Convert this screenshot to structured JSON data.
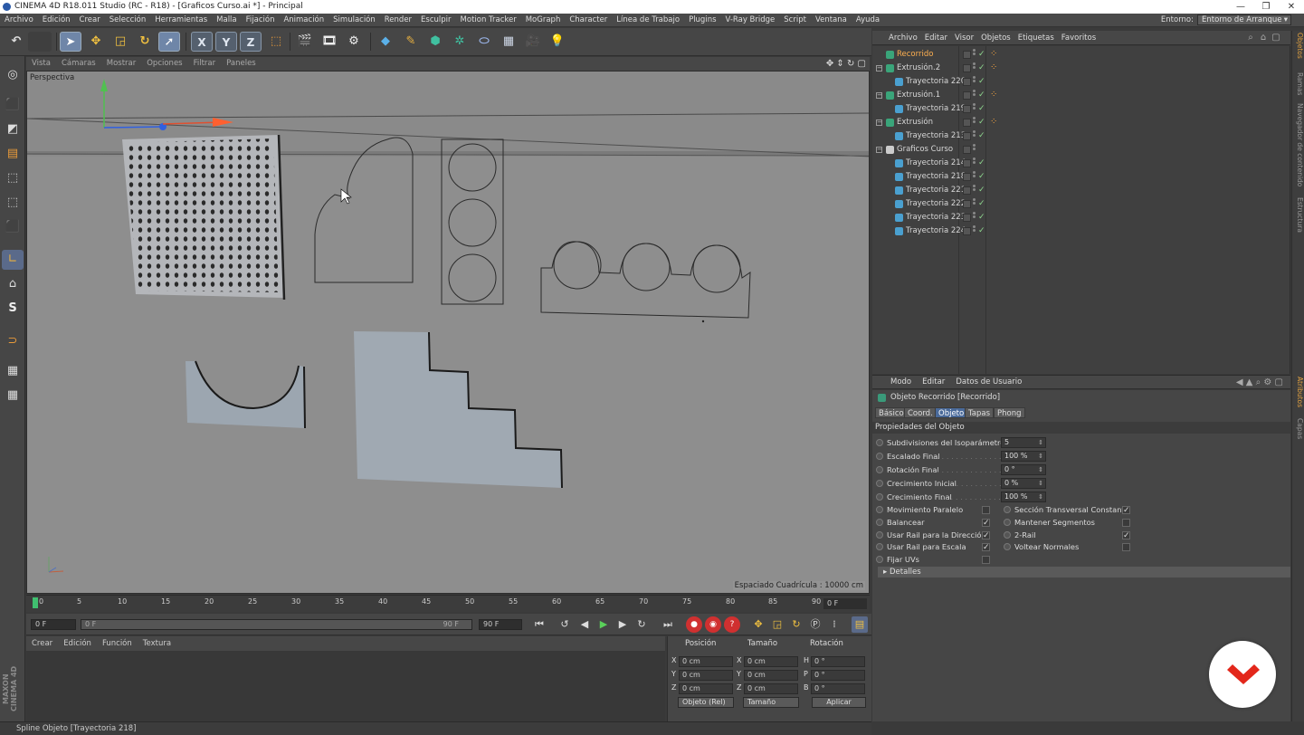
{
  "window": {
    "title": "CINEMA 4D R18.011 Studio (RC - R18) - [Graficos Curso.ai *] - Principal",
    "controls": [
      "—",
      "❐",
      "✕"
    ]
  },
  "menubar": {
    "items": [
      "Archivo",
      "Edición",
      "Crear",
      "Selección",
      "Herramientas",
      "Malla",
      "Fijación",
      "Animación",
      "Simulación",
      "Render",
      "Esculpir",
      "Motion Tracker",
      "MoGraph",
      "Character",
      "Línea de Trabajo",
      "Plugins",
      "V-Ray Bridge",
      "Script",
      "Ventana",
      "Ayuda"
    ],
    "entorno_label": "Entorno:",
    "entorno_value": "Entorno de Arranque"
  },
  "toolbar": {
    "axis_x": "X",
    "axis_y": "Y",
    "axis_z": "Z"
  },
  "left_tools": {
    "s_label": "S",
    "brand": "MAXON CINEMA 4D"
  },
  "viewport": {
    "menu": [
      "Vista",
      "Cámaras",
      "Mostrar",
      "Opciones",
      "Filtrar",
      "Paneles"
    ],
    "label": "Perspectiva",
    "grid_spacing": "Espaciado Cuadrícula : 10000 cm"
  },
  "timeline": {
    "ticks": [
      "0",
      "5",
      "10",
      "15",
      "20",
      "25",
      "30",
      "35",
      "40",
      "45",
      "50",
      "55",
      "60",
      "65",
      "70",
      "75",
      "80",
      "85",
      "90"
    ],
    "current": "0 F"
  },
  "playback": {
    "start_frame": "0 F",
    "range_start": "0 F",
    "range_end": "90 F",
    "end_frame": "90 F"
  },
  "material_manager": {
    "menu": [
      "Crear",
      "Edición",
      "Función",
      "Textura"
    ]
  },
  "coordinates": {
    "headers": [
      "Posición",
      "Tamaño",
      "Rotación"
    ],
    "rows": [
      {
        "axis": "X",
        "pos": "0 cm",
        "size_axis": "X",
        "size": "0 cm",
        "rot_axis": "H",
        "rot": "0 °"
      },
      {
        "axis": "Y",
        "pos": "0 cm",
        "size_axis": "Y",
        "size": "0 cm",
        "rot_axis": "P",
        "rot": "0 °"
      },
      {
        "axis": "Z",
        "pos": "0 cm",
        "size_axis": "Z",
        "size": "0 cm",
        "rot_axis": "B",
        "rot": "0 °"
      }
    ],
    "mode": "Objeto (Rel)",
    "size_mode": "Tamaño",
    "apply": "Aplicar"
  },
  "status": {
    "text": "Spline Objeto [Trayectoria 218]"
  },
  "object_manager": {
    "menu": [
      "Archivo",
      "Editar",
      "Visor",
      "Objetos",
      "Etiquetas",
      "Favoritos"
    ],
    "objects": [
      {
        "name": "Recorrido",
        "level": 0,
        "active": true,
        "expander": "",
        "icon_color": "#3aa57a",
        "checked": true,
        "tag": true
      },
      {
        "name": "Extrusión.2",
        "level": 0,
        "active": false,
        "expander": "−",
        "icon_color": "#3aa57a",
        "checked": true,
        "tag": true
      },
      {
        "name": "Trayectoria 220",
        "level": 1,
        "active": false,
        "expander": "",
        "icon_color": "#4aa0d0",
        "checked": true,
        "tag": false
      },
      {
        "name": "Extrusión.1",
        "level": 0,
        "active": false,
        "expander": "−",
        "icon_color": "#3aa57a",
        "checked": true,
        "tag": true
      },
      {
        "name": "Trayectoria 219",
        "level": 1,
        "active": false,
        "expander": "",
        "icon_color": "#4aa0d0",
        "checked": true,
        "tag": false
      },
      {
        "name": "Extrusión",
        "level": 0,
        "active": false,
        "expander": "−",
        "icon_color": "#3aa57a",
        "checked": true,
        "tag": true
      },
      {
        "name": "Trayectoria 213",
        "level": 1,
        "active": false,
        "expander": "",
        "icon_color": "#4aa0d0",
        "checked": true,
        "tag": false
      },
      {
        "name": "Graficos Curso",
        "level": 0,
        "active": false,
        "expander": "−",
        "icon_color": "#cccccc",
        "checked": false,
        "tag": false
      },
      {
        "name": "Trayectoria 214",
        "level": 1,
        "active": false,
        "expander": "",
        "icon_color": "#4aa0d0",
        "checked": true,
        "tag": false
      },
      {
        "name": "Trayectoria 218",
        "level": 1,
        "active": false,
        "expander": "",
        "icon_color": "#4aa0d0",
        "checked": true,
        "tag": false
      },
      {
        "name": "Trayectoria 221",
        "level": 1,
        "active": false,
        "expander": "",
        "icon_color": "#4aa0d0",
        "checked": true,
        "tag": false
      },
      {
        "name": "Trayectoria 222",
        "level": 1,
        "active": false,
        "expander": "",
        "icon_color": "#4aa0d0",
        "checked": true,
        "tag": false
      },
      {
        "name": "Trayectoria 223",
        "level": 1,
        "active": false,
        "expander": "",
        "icon_color": "#4aa0d0",
        "checked": true,
        "tag": false
      },
      {
        "name": "Trayectoria 224",
        "level": 1,
        "active": false,
        "expander": "",
        "icon_color": "#4aa0d0",
        "checked": true,
        "tag": false
      }
    ]
  },
  "right_tabs": [
    "Objetos",
    "Ramas",
    "Navegador de contenido",
    "Estructura",
    "Atributos",
    "Capas"
  ],
  "attributes": {
    "menu": [
      "Modo",
      "Editar",
      "Datos de Usuario"
    ],
    "title": "Objeto Recorrido [Recorrido]",
    "tabs": [
      "Básico",
      "Coord.",
      "Objeto",
      "Tapas",
      "Phong"
    ],
    "active_tab": "Objeto",
    "section": "Propiedades del Objeto",
    "fields": [
      {
        "label": "Subdivisiones del Isoparámetro",
        "value": "5"
      },
      {
        "label": "Escalado Final",
        "value": "100 %"
      },
      {
        "label": "Rotación Final",
        "value": "0 °"
      },
      {
        "label": "Crecimiento Inicial",
        "value": "0 %"
      },
      {
        "label": "Crecimiento Final",
        "value": "100 %"
      }
    ],
    "checks_left": [
      {
        "label": "Movimiento Paralelo",
        "checked": false
      },
      {
        "label": "Balancear",
        "checked": true
      },
      {
        "label": "Usar Rail para la Dirección",
        "checked": true
      },
      {
        "label": "Usar Rail para Escala",
        "checked": true
      },
      {
        "label": "Fijar UVs",
        "checked": false
      }
    ],
    "checks_right": [
      {
        "label": "Sección Transversal Constante",
        "checked": true
      },
      {
        "label": "Mantener Segmentos",
        "checked": false
      },
      {
        "label": "2-Rail",
        "checked": true
      },
      {
        "label": "Voltear Normales",
        "checked": false
      }
    ],
    "details": "Detalles"
  },
  "colors": {
    "accent": "#e0a040",
    "selection": "#4a6a9a",
    "badge_red": "#e3271b"
  }
}
